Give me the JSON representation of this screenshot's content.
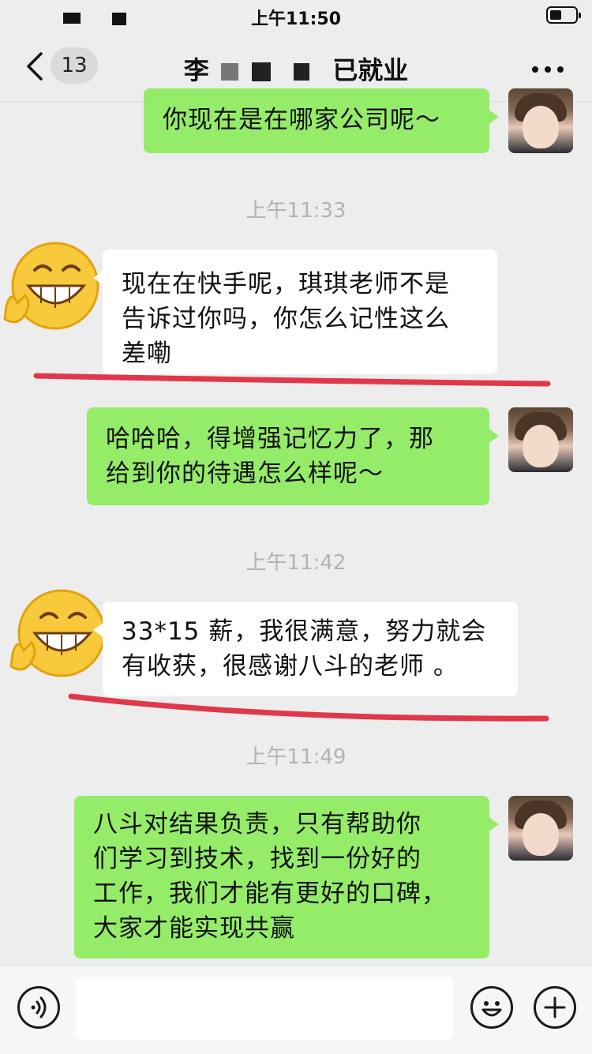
{
  "status_bar": {
    "time": "上午11:50"
  },
  "nav": {
    "unread_count": "13",
    "title_prefix": "李",
    "title_suffix": "已就业"
  },
  "messages": [
    {
      "from": "self",
      "text": "你现在是在哪家公司呢～"
    },
    {
      "timestamp": "上午11:33"
    },
    {
      "from": "other",
      "text": "现在在快手呢，琪琪老师不是\n告诉过你吗，你怎么记性这么\n差嘞"
    },
    {
      "from": "self",
      "text": "哈哈哈，得增强记忆力了，那\n给到你的待遇怎么样呢～"
    },
    {
      "timestamp": "上午11:42"
    },
    {
      "from": "other",
      "text": "33*15 薪，我很满意，努力就会\n有收获，很感谢八斗的老师 。"
    },
    {
      "timestamp": "上午11:49"
    },
    {
      "from": "self",
      "text": "八斗对结果负责，只有帮助你\n们学习到技术，找到一份好的\n工作，我们才能有更好的口碑，\n大家才能实现共赢"
    }
  ],
  "icons": {
    "back": "chevron-left-icon",
    "more": "more-dots-icon",
    "voice": "voice-icon",
    "emoji": "emoji-icon",
    "add": "plus-icon"
  },
  "colors": {
    "self_bubble": "#95ec69",
    "other_bubble": "#ffffff",
    "highlight_line": "#e0384a"
  }
}
